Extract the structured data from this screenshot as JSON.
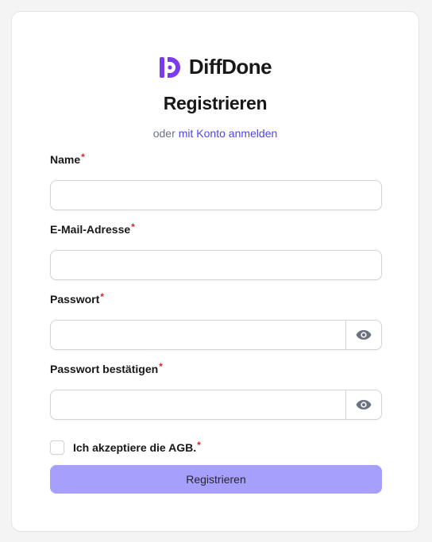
{
  "brand": {
    "name": "DiffDone",
    "accent": "#7c3aed"
  },
  "page": {
    "title": "Registrieren",
    "subtitle_prefix": "oder",
    "subtitle_link": "mit Konto anmelden",
    "link_color": "#4f46e5"
  },
  "form": {
    "required_mark": "*",
    "name": {
      "label": "Name",
      "value": ""
    },
    "email": {
      "label": "E-Mail-Adresse",
      "value": ""
    },
    "password": {
      "label": "Passwort",
      "value": "",
      "toggle_icon": "eye-icon"
    },
    "password_confirm": {
      "label": "Passwort bestätigen",
      "value": "",
      "toggle_icon": "eye-icon"
    },
    "terms": {
      "label": "Ich akzeptiere die AGB.",
      "checked": false
    },
    "submit_label": "Registrieren",
    "submit_color": "#a5a0fb"
  }
}
